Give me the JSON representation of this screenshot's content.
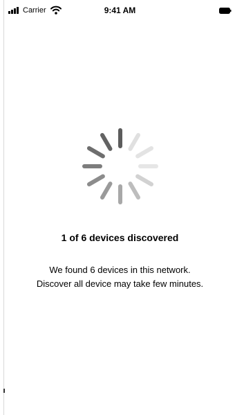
{
  "status_bar": {
    "carrier": "Carrier",
    "time": "9:41 AM"
  },
  "discovery": {
    "title": "1 of 6 devices discovered",
    "description_line1": "We found 6 devices in this network.",
    "description_line2": "Discover all device may take few minutes."
  },
  "colors": {
    "text": "#000000",
    "background": "#ffffff",
    "spinner_dark": "#5a5a5a",
    "spinner_light": "#e6e6e6"
  }
}
